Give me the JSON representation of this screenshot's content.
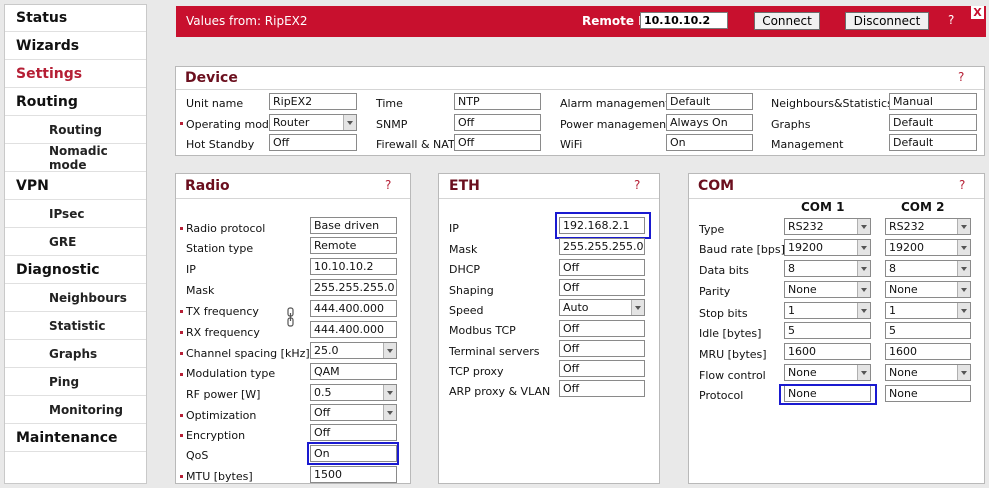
{
  "sidebar": {
    "items": [
      {
        "label": "Status"
      },
      {
        "label": "Wizards"
      },
      {
        "label": "Settings"
      },
      {
        "label": "Routing"
      },
      {
        "label": "Routing"
      },
      {
        "label": "Nomadic mode"
      },
      {
        "label": "VPN"
      },
      {
        "label": "IPsec"
      },
      {
        "label": "GRE"
      },
      {
        "label": "Diagnostic"
      },
      {
        "label": "Neighbours"
      },
      {
        "label": "Statistic"
      },
      {
        "label": "Graphs"
      },
      {
        "label": "Ping"
      },
      {
        "label": "Monitoring"
      },
      {
        "label": "Maintenance"
      }
    ]
  },
  "topbar": {
    "values_from": "Values from: RipEX2",
    "remote_ip_label": "Remote IP",
    "remote_ip_value": "10.10.10.2",
    "connect_label": "Connect",
    "disconnect_label": "Disconnect",
    "help": "?",
    "close": "X"
  },
  "device": {
    "title": "Device",
    "help": "?",
    "col1": {
      "unit_name_label": "Unit name",
      "unit_name_value": "RipEX2",
      "operating_mode_label": "Operating mode",
      "operating_mode_value": "Router",
      "hot_standby_label": "Hot Standby",
      "hot_standby_value": "Off"
    },
    "col2": {
      "time_label": "Time",
      "time_value": "NTP",
      "snmp_label": "SNMP",
      "snmp_value": "Off",
      "firewall_label": "Firewall & NAT",
      "firewall_value": "Off"
    },
    "col3": {
      "alarm_label": "Alarm management",
      "alarm_value": "Default",
      "power_label": "Power management",
      "power_value": "Always On",
      "wifi_label": "WiFi",
      "wifi_value": "On"
    },
    "col4": {
      "neighbours_label": "Neighbours&Statistics",
      "neighbours_value": "Manual",
      "graphs_label": "Graphs",
      "graphs_value": "Default",
      "management_label": "Management",
      "management_value": "Default"
    }
  },
  "radio": {
    "title": "Radio",
    "help": "?",
    "rows": [
      {
        "label": "Radio protocol",
        "value": "Base driven"
      },
      {
        "label": "Station type",
        "value": "Remote"
      },
      {
        "label": "IP",
        "value": "10.10.10.2"
      },
      {
        "label": "Mask",
        "value": "255.255.255.0"
      },
      {
        "label": "TX frequency",
        "value": "444.400.000"
      },
      {
        "label": "RX frequency",
        "value": "444.400.000"
      },
      {
        "label": "Channel spacing [kHz]",
        "value": "25.0"
      },
      {
        "label": "Modulation type",
        "value": "QAM"
      },
      {
        "label": "RF power [W]",
        "value": "0.5"
      },
      {
        "label": "Optimization",
        "value": "Off"
      },
      {
        "label": "Encryption",
        "value": "Off"
      },
      {
        "label": "QoS",
        "value": "On"
      },
      {
        "label": "MTU [bytes]",
        "value": "1500"
      }
    ]
  },
  "eth": {
    "title": "ETH",
    "help": "?",
    "rows": [
      {
        "label": "IP",
        "value": "192.168.2.1"
      },
      {
        "label": "Mask",
        "value": "255.255.255.0"
      },
      {
        "label": "DHCP",
        "value": "Off"
      },
      {
        "label": "Shaping",
        "value": "Off"
      },
      {
        "label": "Speed",
        "value": "Auto"
      },
      {
        "label": "Modbus TCP",
        "value": "Off"
      },
      {
        "label": "Terminal servers",
        "value": "Off"
      },
      {
        "label": "TCP proxy",
        "value": "Off"
      },
      {
        "label": "ARP proxy & VLAN",
        "value": "Off"
      }
    ]
  },
  "com": {
    "title": "COM",
    "help": "?",
    "col1_header": "COM 1",
    "col2_header": "COM 2",
    "rows": [
      {
        "label": "Type",
        "com1": "RS232",
        "com2": "RS232"
      },
      {
        "label": "Baud rate [bps]",
        "com1": "19200",
        "com2": "19200"
      },
      {
        "label": "Data bits",
        "com1": "8",
        "com2": "8"
      },
      {
        "label": "Parity",
        "com1": "None",
        "com2": "None"
      },
      {
        "label": "Stop bits",
        "com1": "1",
        "com2": "1"
      },
      {
        "label": "Idle [bytes]",
        "com1": "5",
        "com2": "5"
      },
      {
        "label": "MRU [bytes]",
        "com1": "1600",
        "com2": "1600"
      },
      {
        "label": "Flow control",
        "com1": "None",
        "com2": "None"
      },
      {
        "label": "Protocol",
        "com1": "None",
        "com2": "None"
      }
    ]
  },
  "colors": {
    "accent": "#c8102e",
    "title_text": "#6b0f1e",
    "highlight_border": "#1a1ad0"
  }
}
